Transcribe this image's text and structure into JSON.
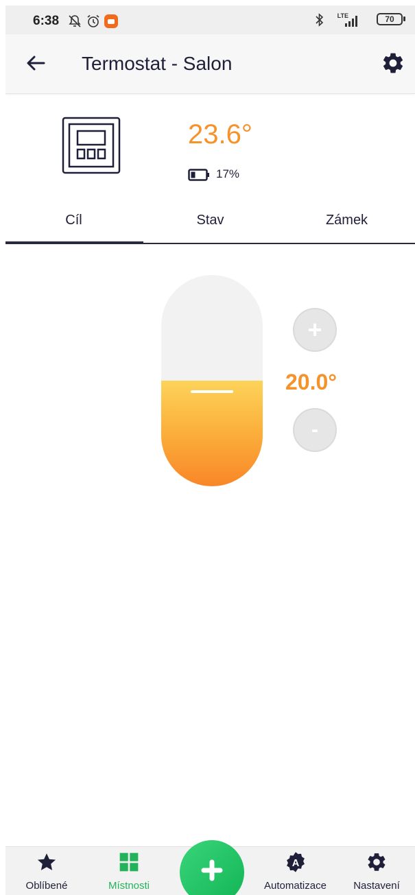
{
  "status_bar": {
    "time": "6:38",
    "network": "LTE",
    "battery": "70"
  },
  "header": {
    "title": "Termostat - Salon",
    "back_icon": "arrow-left-icon",
    "settings_icon": "gear-icon"
  },
  "device": {
    "icon": "thermostat-device-icon",
    "current_temperature": "23.6°",
    "battery_percent": "17%",
    "battery_level": 0.17
  },
  "tabs": [
    {
      "label": "Cíl",
      "active": true
    },
    {
      "label": "Stav",
      "active": false
    },
    {
      "label": "Zámek",
      "active": false
    }
  ],
  "thermostat": {
    "target_temperature": "20.0°",
    "increase_label": "+",
    "decrease_label": "-",
    "fill_fraction": 0.5,
    "accent_color": "#f5922a"
  },
  "bottom_nav": {
    "items": [
      {
        "label": "Oblíbené",
        "icon": "star-icon",
        "active": false
      },
      {
        "label": "Místnosti",
        "icon": "grid-icon",
        "active": true
      },
      {
        "label": "Automatizace",
        "icon": "automation-icon",
        "active": false
      },
      {
        "label": "Nastavení",
        "icon": "gear-icon",
        "active": false
      }
    ],
    "active_color": "#22b35a",
    "add_icon": "plus-icon"
  }
}
